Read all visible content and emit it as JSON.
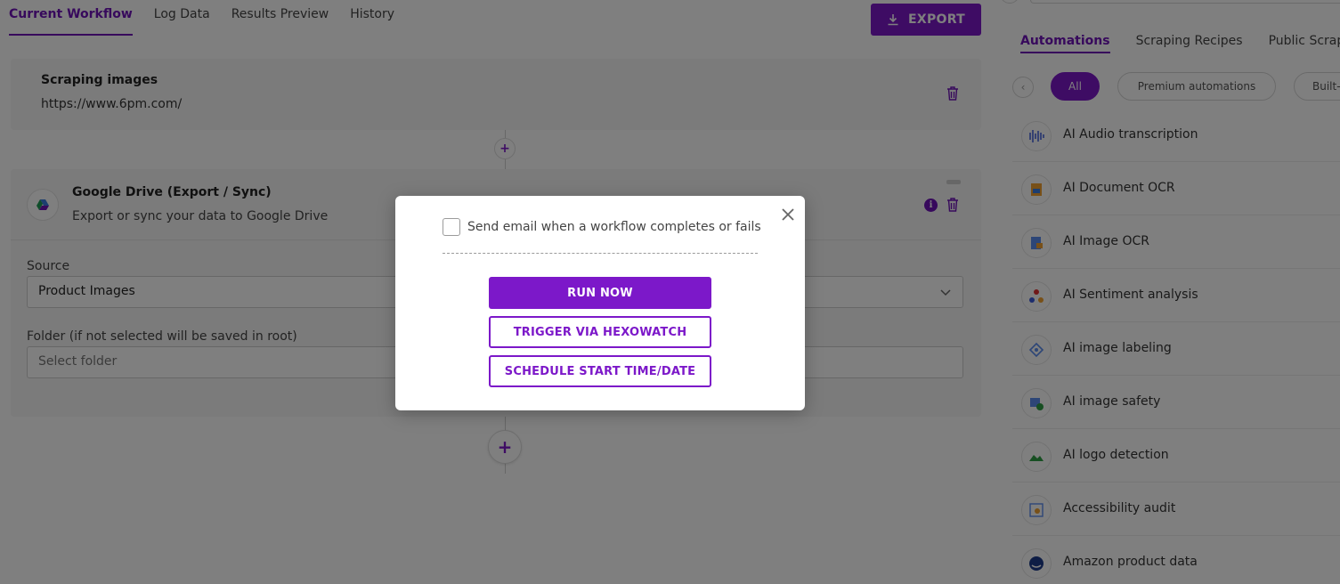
{
  "workflow_tabs": [
    {
      "label": "Current Workflow",
      "active": true
    },
    {
      "label": "Log Data",
      "active": false
    },
    {
      "label": "Results Preview",
      "active": false
    },
    {
      "label": "History",
      "active": false
    }
  ],
  "export_button": {
    "label": "EXPORT",
    "icon": "download-icon"
  },
  "step1": {
    "title": "Scraping images",
    "url": "https://www.6pm.com/",
    "icon": "trash-icon"
  },
  "step2": {
    "title": "Google Drive (Export / Sync)",
    "description": "Export or sync your data to Google Drive",
    "icon": "google-drive-icon",
    "source_label": "Source",
    "source_value": "Product Images",
    "folder_label": "Folder (if not selected will be saved in root)",
    "folder_placeholder": "Select folder"
  },
  "add_step_symbol": "+",
  "right_panel": {
    "tabs": [
      {
        "label": "Automations",
        "active": true
      },
      {
        "label": "Scraping Recipes",
        "active": false
      },
      {
        "label": "Public Scrap",
        "active": false
      }
    ],
    "filters": [
      {
        "label": "All",
        "active": true
      },
      {
        "label": "Premium automations",
        "active": false
      },
      {
        "label": "Built-",
        "active": false
      }
    ],
    "automations": [
      {
        "label": "AI Audio transcription",
        "icon": "audio-waveform-icon"
      },
      {
        "label": "AI Document OCR",
        "icon": "document-ocr-icon"
      },
      {
        "label": "AI Image OCR",
        "icon": "image-ocr-icon"
      },
      {
        "label": "AI Sentiment analysis",
        "icon": "sentiment-icon"
      },
      {
        "label": "AI image labeling",
        "icon": "image-label-icon"
      },
      {
        "label": "AI image safety",
        "icon": "image-safety-icon"
      },
      {
        "label": "AI logo detection",
        "icon": "logo-detection-icon"
      },
      {
        "label": "Accessibility audit",
        "icon": "accessibility-icon"
      },
      {
        "label": "Amazon product data",
        "icon": "amazon-icon"
      }
    ]
  },
  "modal": {
    "checkbox_label": "Send email when a workflow completes or fails",
    "checkbox_checked": false,
    "run_now": "RUN NOW",
    "trigger": "TRIGGER VIA HEXOWATCH",
    "schedule": "SCHEDULE START TIME/DATE"
  },
  "colors": {
    "accent": "#7c18c9",
    "overlay": "rgba(0,0,0,0.5)"
  }
}
